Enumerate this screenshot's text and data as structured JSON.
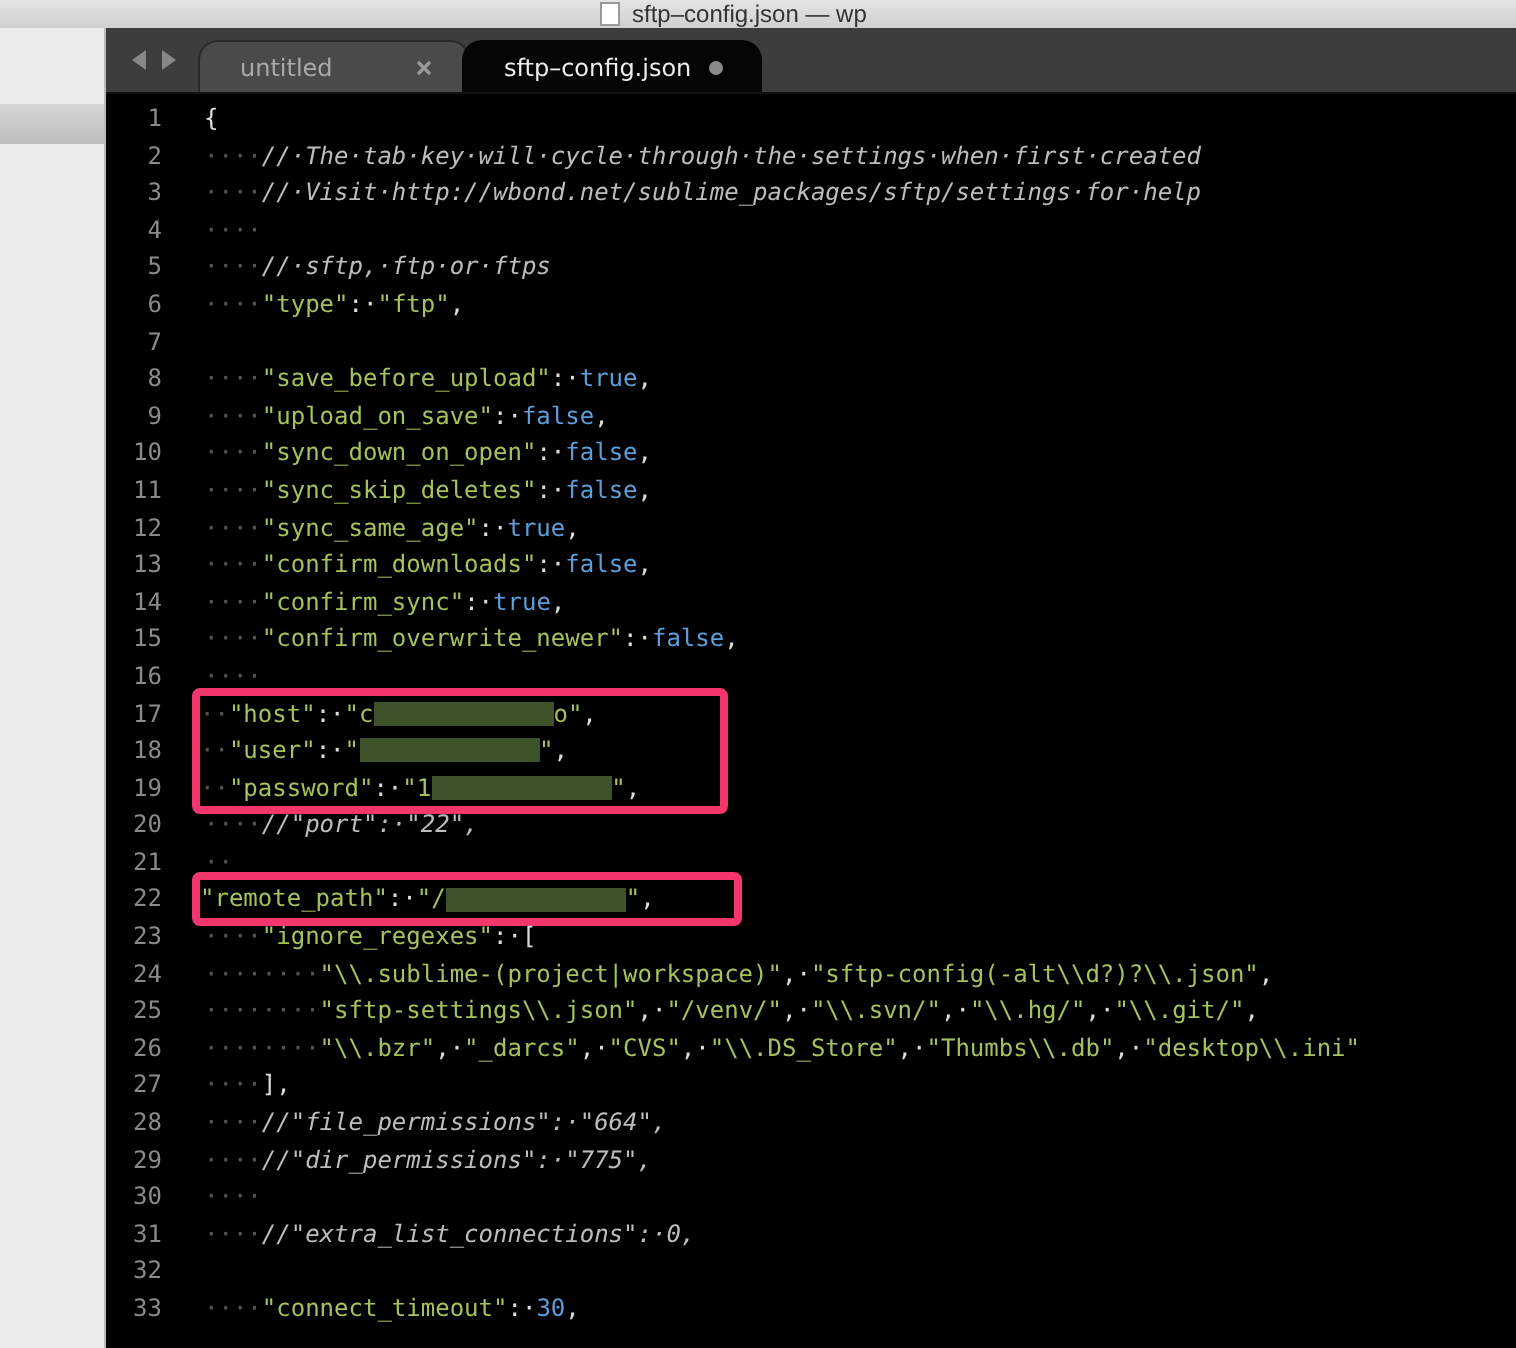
{
  "window": {
    "title": "sftp–config.json — wp"
  },
  "tabs": [
    {
      "label": "untitled",
      "selected": false,
      "modified": false
    },
    {
      "label": "sftp–config.json",
      "selected": true,
      "modified": true
    }
  ],
  "editor": {
    "lines": [
      {
        "number": "1",
        "boxed": false,
        "tokens": [
          {
            "kind": "punct",
            "text": "{"
          }
        ]
      },
      {
        "number": "2",
        "boxed": false,
        "tokens": [
          {
            "kind": "ws",
            "text": "····"
          },
          {
            "kind": "comment",
            "text": "//·The·tab·key·will·cycle·through·the·settings·when·first·created"
          }
        ]
      },
      {
        "number": "3",
        "boxed": false,
        "tokens": [
          {
            "kind": "ws",
            "text": "····"
          },
          {
            "kind": "comment",
            "text": "//·Visit·http://wbond.net/sublime_packages/sftp/settings·for·help"
          }
        ]
      },
      {
        "number": "4",
        "boxed": false,
        "tokens": [
          {
            "kind": "ws",
            "text": "····"
          }
        ]
      },
      {
        "number": "5",
        "boxed": false,
        "tokens": [
          {
            "kind": "ws",
            "text": "····"
          },
          {
            "kind": "comment",
            "text": "//·sftp,·ftp·or·ftps"
          }
        ]
      },
      {
        "number": "6",
        "boxed": false,
        "tokens": [
          {
            "kind": "ws",
            "text": "····"
          },
          {
            "kind": "string",
            "text": "\"type\""
          },
          {
            "kind": "punct",
            "text": ":·"
          },
          {
            "kind": "string",
            "text": "\"ftp\""
          },
          {
            "kind": "punct",
            "text": ","
          }
        ]
      },
      {
        "number": "7",
        "boxed": false
      },
      {
        "number": "8",
        "boxed": false,
        "tokens": [
          {
            "kind": "ws",
            "text": "····"
          },
          {
            "kind": "string",
            "text": "\"save_before_upload\""
          },
          {
            "kind": "punct",
            "text": ":·"
          },
          {
            "kind": "bool",
            "text": "true"
          },
          {
            "kind": "punct",
            "text": ","
          }
        ]
      },
      {
        "number": "9",
        "boxed": false,
        "tokens": [
          {
            "kind": "ws",
            "text": "····"
          },
          {
            "kind": "string",
            "text": "\"upload_on_save\""
          },
          {
            "kind": "punct",
            "text": ":·"
          },
          {
            "kind": "bool",
            "text": "false"
          },
          {
            "kind": "punct",
            "text": ","
          }
        ]
      },
      {
        "number": "10",
        "boxed": false,
        "tokens": [
          {
            "kind": "ws",
            "text": "····"
          },
          {
            "kind": "string",
            "text": "\"sync_down_on_open\""
          },
          {
            "kind": "punct",
            "text": ":·"
          },
          {
            "kind": "bool",
            "text": "false"
          },
          {
            "kind": "punct",
            "text": ","
          }
        ]
      },
      {
        "number": "11",
        "boxed": false,
        "tokens": [
          {
            "kind": "ws",
            "text": "····"
          },
          {
            "kind": "string",
            "text": "\"sync_skip_deletes\""
          },
          {
            "kind": "punct",
            "text": ":·"
          },
          {
            "kind": "bool",
            "text": "false"
          },
          {
            "kind": "punct",
            "text": ","
          }
        ]
      },
      {
        "number": "12",
        "boxed": false,
        "tokens": [
          {
            "kind": "ws",
            "text": "····"
          },
          {
            "kind": "string",
            "text": "\"sync_same_age\""
          },
          {
            "kind": "punct",
            "text": ":·"
          },
          {
            "kind": "bool",
            "text": "true"
          },
          {
            "kind": "punct",
            "text": ","
          }
        ]
      },
      {
        "number": "13",
        "boxed": false,
        "tokens": [
          {
            "kind": "ws",
            "text": "····"
          },
          {
            "kind": "string",
            "text": "\"confirm_downloads\""
          },
          {
            "kind": "punct",
            "text": ":·"
          },
          {
            "kind": "bool",
            "text": "false"
          },
          {
            "kind": "punct",
            "text": ","
          }
        ]
      },
      {
        "number": "14",
        "boxed": false,
        "tokens": [
          {
            "kind": "ws",
            "text": "····"
          },
          {
            "kind": "string",
            "text": "\"confirm_sync\""
          },
          {
            "kind": "punct",
            "text": ":·"
          },
          {
            "kind": "bool",
            "text": "true"
          },
          {
            "kind": "punct",
            "text": ","
          }
        ]
      },
      {
        "number": "15",
        "boxed": false,
        "tokens": [
          {
            "kind": "ws",
            "text": "····"
          },
          {
            "kind": "string",
            "text": "\"confirm_overwrite_newer\""
          },
          {
            "kind": "punct",
            "text": ":·"
          },
          {
            "kind": "bool",
            "text": "false"
          },
          {
            "kind": "punct",
            "text": ","
          }
        ]
      },
      {
        "number": "16",
        "boxed": false,
        "tokens": [
          {
            "kind": "ws",
            "text": "····"
          }
        ]
      },
      {
        "number": "17",
        "boxed": true,
        "tokens": [
          {
            "kind": "ws",
            "text": "··"
          },
          {
            "kind": "string",
            "text": "\"host\""
          },
          {
            "kind": "punct",
            "text": ":·"
          },
          {
            "kind": "string",
            "text": "\"c"
          },
          {
            "kind": "redacted"
          },
          {
            "kind": "string",
            "text": "o\""
          },
          {
            "kind": "punct",
            "text": ","
          }
        ]
      },
      {
        "number": "18",
        "boxed": true,
        "tokens": [
          {
            "kind": "ws",
            "text": "··"
          },
          {
            "kind": "string",
            "text": "\"user\""
          },
          {
            "kind": "punct",
            "text": ":·"
          },
          {
            "kind": "string",
            "text": "\""
          },
          {
            "kind": "redacted"
          },
          {
            "kind": "string",
            "text": "\""
          },
          {
            "kind": "punct",
            "text": ","
          }
        ]
      },
      {
        "number": "19",
        "boxed": true,
        "tokens": [
          {
            "kind": "ws",
            "text": "··"
          },
          {
            "kind": "string",
            "text": "\"password\""
          },
          {
            "kind": "punct",
            "text": ":·"
          },
          {
            "kind": "string",
            "text": "\"1"
          },
          {
            "kind": "redacted"
          },
          {
            "kind": "string",
            "text": "\""
          },
          {
            "kind": "punct",
            "text": ","
          }
        ]
      },
      {
        "number": "20",
        "boxed": false,
        "tokens": [
          {
            "kind": "ws",
            "text": "····"
          },
          {
            "kind": "comment",
            "text": "//\"port\":·\"22\","
          }
        ]
      },
      {
        "number": "21",
        "boxed": false,
        "tokens": [
          {
            "kind": "ws",
            "text": "··"
          }
        ]
      },
      {
        "number": "22",
        "boxed": true,
        "tokens": [
          {
            "kind": "string",
            "text": "\"remote_path\""
          },
          {
            "kind": "punct",
            "text": ":·"
          },
          {
            "kind": "string",
            "text": "\"/"
          },
          {
            "kind": "redacted"
          },
          {
            "kind": "string",
            "text": "\""
          },
          {
            "kind": "punct",
            "text": ","
          }
        ]
      },
      {
        "number": "23",
        "boxed": false,
        "tokens": [
          {
            "kind": "ws",
            "text": "····"
          },
          {
            "kind": "string",
            "text": "\"ignore_regexes\""
          },
          {
            "kind": "punct",
            "text": ":·["
          }
        ]
      },
      {
        "number": "24",
        "boxed": false,
        "tokens": [
          {
            "kind": "ws",
            "text": "········"
          },
          {
            "kind": "string",
            "text": "\"\\\\.sublime-(project|workspace)\""
          },
          {
            "kind": "punct",
            "text": ",·"
          },
          {
            "kind": "string",
            "text": "\"sftp-config(-alt\\\\d?)?\\\\.json\""
          },
          {
            "kind": "punct",
            "text": ","
          }
        ]
      },
      {
        "number": "25",
        "boxed": false,
        "tokens": [
          {
            "kind": "ws",
            "text": "········"
          },
          {
            "kind": "string",
            "text": "\"sftp-settings\\\\.json\""
          },
          {
            "kind": "punct",
            "text": ",·"
          },
          {
            "kind": "string",
            "text": "\"/venv/\""
          },
          {
            "kind": "punct",
            "text": ",·"
          },
          {
            "kind": "string",
            "text": "\"\\\\.svn/\""
          },
          {
            "kind": "punct",
            "text": ",·"
          },
          {
            "kind": "string",
            "text": "\"\\\\.hg/\""
          },
          {
            "kind": "punct",
            "text": ",·"
          },
          {
            "kind": "string",
            "text": "\"\\\\.git/\""
          },
          {
            "kind": "punct",
            "text": ","
          }
        ]
      },
      {
        "number": "26",
        "boxed": false,
        "tokens": [
          {
            "kind": "ws",
            "text": "········"
          },
          {
            "kind": "string",
            "text": "\"\\\\.bzr\""
          },
          {
            "kind": "punct",
            "text": ",·"
          },
          {
            "kind": "string",
            "text": "\"_darcs\""
          },
          {
            "kind": "punct",
            "text": ",·"
          },
          {
            "kind": "string",
            "text": "\"CVS\""
          },
          {
            "kind": "punct",
            "text": ",·"
          },
          {
            "kind": "string",
            "text": "\"\\\\.DS_Store\""
          },
          {
            "kind": "punct",
            "text": ",·"
          },
          {
            "kind": "string",
            "text": "\"Thumbs\\\\.db\""
          },
          {
            "kind": "punct",
            "text": ",·"
          },
          {
            "kind": "string",
            "text": "\"desktop\\\\.ini\""
          }
        ]
      },
      {
        "number": "27",
        "boxed": false,
        "tokens": [
          {
            "kind": "ws",
            "text": "····"
          },
          {
            "kind": "punct",
            "text": "],"
          }
        ]
      },
      {
        "number": "28",
        "boxed": false,
        "tokens": [
          {
            "kind": "ws",
            "text": "····"
          },
          {
            "kind": "comment",
            "text": "//\"file_permissions\":·\"664\","
          }
        ]
      },
      {
        "number": "29",
        "boxed": false,
        "tokens": [
          {
            "kind": "ws",
            "text": "····"
          },
          {
            "kind": "comment",
            "text": "//\"dir_permissions\":·\"775\","
          }
        ]
      },
      {
        "number": "30",
        "boxed": false,
        "tokens": [
          {
            "kind": "ws",
            "text": "····"
          }
        ]
      },
      {
        "number": "31",
        "boxed": false,
        "tokens": [
          {
            "kind": "ws",
            "text": "····"
          },
          {
            "kind": "comment",
            "text": "//\"extra_list_connections\":·0,"
          }
        ]
      },
      {
        "number": "32",
        "boxed": false
      },
      {
        "number": "33",
        "boxed": false,
        "tokens": [
          {
            "kind": "ws",
            "text": "····"
          },
          {
            "kind": "string",
            "text": "\"connect_timeout\""
          },
          {
            "kind": "punct",
            "text": ":·"
          },
          {
            "kind": "number",
            "text": "30"
          },
          {
            "kind": "punct",
            "text": ","
          }
        ]
      }
    ]
  }
}
